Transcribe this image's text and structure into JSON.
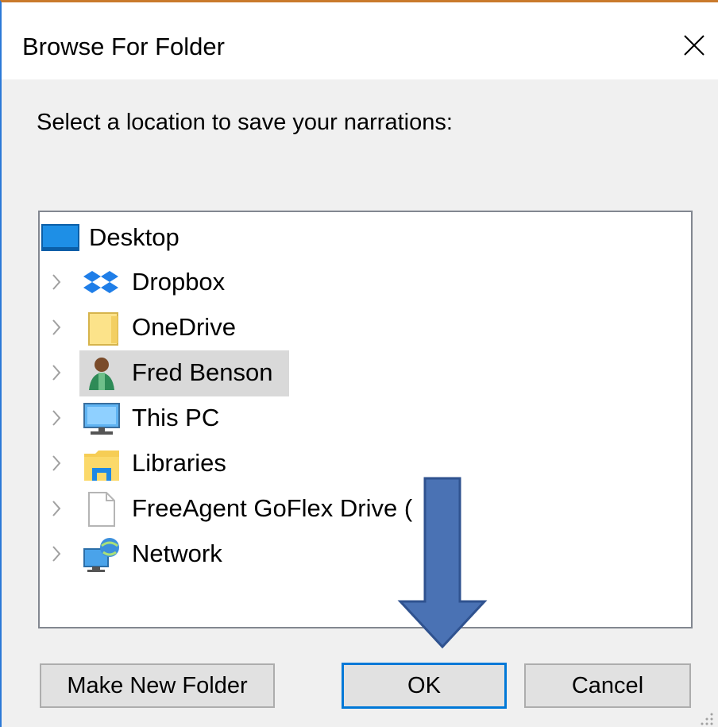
{
  "window": {
    "title": "Browse For Folder",
    "close_icon": "close-icon"
  },
  "prompt": "Select a location to save your narrations:",
  "tree": {
    "items": [
      {
        "label": "Desktop",
        "icon": "desktop-icon",
        "expandable": false
      },
      {
        "label": "Dropbox",
        "icon": "dropbox-icon",
        "expandable": true
      },
      {
        "label": "OneDrive",
        "icon": "folder-icon",
        "expandable": true
      },
      {
        "label": "Fred Benson",
        "icon": "user-icon",
        "expandable": true,
        "selected": true
      },
      {
        "label": "This PC",
        "icon": "computer-icon",
        "expandable": true
      },
      {
        "label": "Libraries",
        "icon": "libraries-icon",
        "expandable": true
      },
      {
        "label": "FreeAgent GoFlex Drive (",
        "icon": "drive-icon",
        "expandable": true
      },
      {
        "label": "Network",
        "icon": "network-icon",
        "expandable": true
      }
    ]
  },
  "buttons": {
    "make_new_folder": "Make New Folder",
    "ok": "OK",
    "cancel": "Cancel"
  },
  "colors": {
    "accent": "#0078d7",
    "arrow_fill": "#4a72b4",
    "arrow_stroke": "#2f528f",
    "selection": "#d9d9d9"
  }
}
